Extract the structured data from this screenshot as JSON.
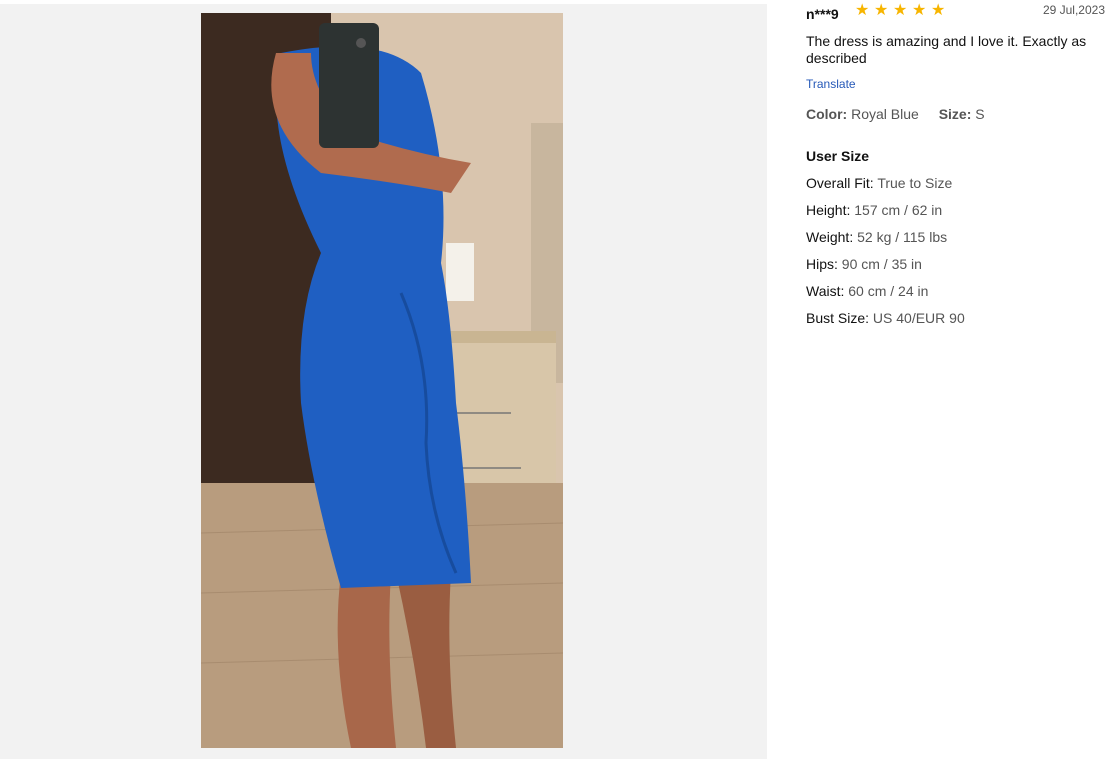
{
  "review": {
    "author": "n***9",
    "rating": 5,
    "date": "29 Jul,2023",
    "comment": "The dress is amazing and I love it. Exactly as described",
    "translate_label": "Translate",
    "color_label": "Color:",
    "color_value": "Royal Blue",
    "size_label": "Size:",
    "size_value": "S"
  },
  "user_size": {
    "title": "User Size",
    "rows": [
      {
        "label": "Overall Fit:",
        "value": "True to Size"
      },
      {
        "label": "Height:",
        "value": "157 cm / 62 in"
      },
      {
        "label": "Weight:",
        "value": "52 kg / 115 lbs"
      },
      {
        "label": "Hips:",
        "value": "90 cm / 35 in"
      },
      {
        "label": "Waist:",
        "value": "60 cm / 24 in"
      },
      {
        "label": "Bust Size:",
        "value": "US 40/EUR 90"
      }
    ]
  },
  "icons": {
    "star": "star-icon"
  },
  "colors": {
    "star": "#f7b500",
    "dress": "#1f5fc2",
    "link": "#2659b8"
  }
}
